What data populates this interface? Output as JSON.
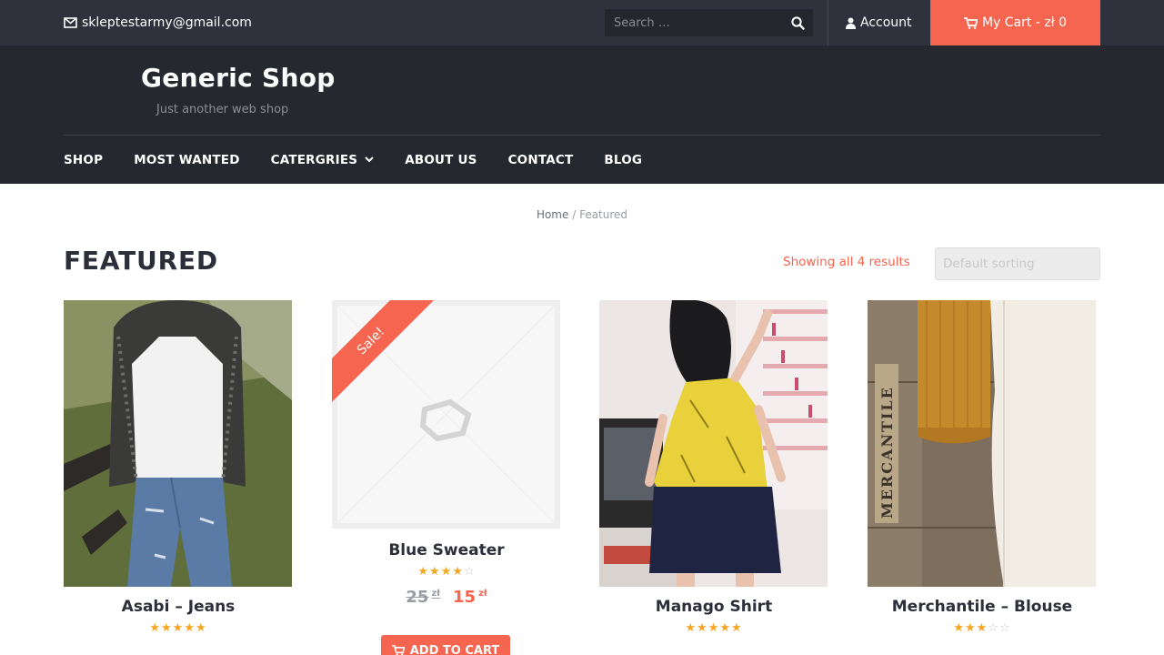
{
  "topbar": {
    "email": "skleptestarmy@gmail.com",
    "search_placeholder": "Search …",
    "account_label": "Account",
    "cart_label": "My Cart - zł 0"
  },
  "site": {
    "title": "Generic Shop",
    "tagline": "Just another web shop"
  },
  "nav": {
    "items": [
      "SHOP",
      "MOST WANTED",
      "CATERGRIES",
      "ABOUT US",
      "CONTACT",
      "BLOG"
    ]
  },
  "breadcrumb": {
    "home": "Home",
    "separator": "/",
    "current": "Featured"
  },
  "page": {
    "title": "FEATURED",
    "result_count": "Showing all 4 results",
    "sorting_value": "Default sorting"
  },
  "products": [
    {
      "name": "Asabi – Jeans",
      "rating": 5
    },
    {
      "name": "Blue Sweater",
      "rating": 4,
      "sale_badge": "Sale!",
      "old_price": "25",
      "new_price": "15",
      "currency": "zł",
      "add_to_cart": "ADD TO CART"
    },
    {
      "name": "Manago Shirt",
      "rating": 5
    },
    {
      "name": "Merchantile – Blouse",
      "rating": 3
    }
  ],
  "colors": {
    "accent": "#f5654f",
    "topbar": "#2f323d",
    "header": "#262830",
    "star": "#f5a623"
  }
}
